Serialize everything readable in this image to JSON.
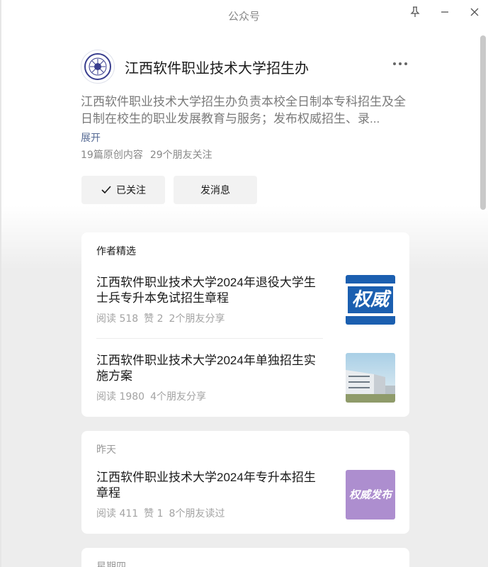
{
  "window": {
    "title": "公众号"
  },
  "profile": {
    "name": "江西软件职业技术大学招生办",
    "description": "江西软件职业技术大学招生办负责本校全日制本专科招生及全日制在校生的职业发展教育与服务；发布权威招生、录...",
    "expand_label": "展开",
    "original_count": "19篇原创内容",
    "friends_following": "29个朋友关注",
    "follow_label": "已关注",
    "message_label": "发消息"
  },
  "sections": [
    {
      "label": "作者精选",
      "articles": [
        {
          "title": "江西软件职业技术大学2024年退役大学生士兵专升本免试招生章程",
          "reads": "阅读 518",
          "likes": "赞 2",
          "social": "2个朋友分享",
          "thumb": "权威"
        },
        {
          "title": "江西软件职业技术大学2024年单独招生实施方案",
          "reads": "阅读 1980",
          "social": "4个朋友分享",
          "thumb": "building-photo"
        }
      ]
    },
    {
      "label": "昨天",
      "articles": [
        {
          "title": "江西软件职业技术大学2024年专升本招生章程",
          "reads": "阅读 411",
          "likes": "赞 1",
          "social": "8个朋友读过",
          "thumb": "权威发布"
        }
      ]
    },
    {
      "label": "星期四"
    }
  ],
  "colors": {
    "link": "#576b95",
    "thumb_blue": "#1b5fb0",
    "thumb_purple": "#ad8ecf"
  }
}
